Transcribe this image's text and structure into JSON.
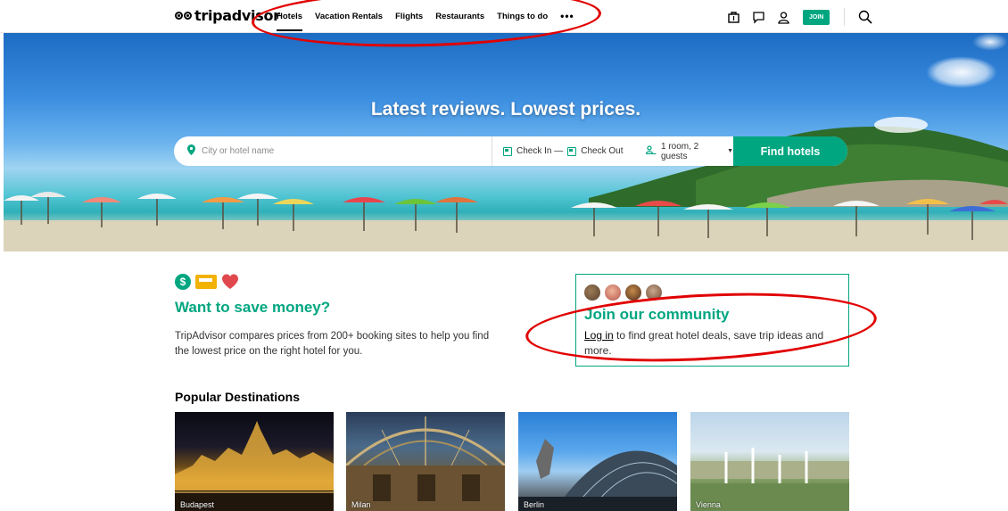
{
  "header": {
    "logo_text": "tripadvisor",
    "nav": [
      {
        "label": "Hotels"
      },
      {
        "label": "Vacation Rentals"
      },
      {
        "label": "Flights"
      },
      {
        "label": "Restaurants"
      },
      {
        "label": "Things to do"
      }
    ],
    "more_label": "•••",
    "join_label": "JOIN"
  },
  "hero": {
    "title": "Latest reviews. Lowest prices.",
    "search": {
      "where_placeholder": "City or hotel name",
      "check_in": "Check In —",
      "check_out": "Check Out",
      "guests": "1 room, 2 guests",
      "find_label": "Find hotels"
    }
  },
  "save": {
    "title": "Want to save money?",
    "description": "TripAdvisor compares prices from 200+ booking sites to help you find the lowest price on the right hotel for you."
  },
  "community": {
    "title": "Join our community",
    "login_link": "Log in",
    "description_rest": " to find great hotel deals, save trip ideas and more."
  },
  "popular": {
    "title": "Popular Destinations",
    "destinations": [
      {
        "name": "Budapest"
      },
      {
        "name": "Milan"
      },
      {
        "name": "Berlin"
      },
      {
        "name": "Vienna"
      }
    ]
  },
  "colors": {
    "brand_green": "#00a680",
    "annotation_red": "#e10000",
    "bed_yellow": "#f2b203",
    "heart_red": "#e0484e"
  }
}
